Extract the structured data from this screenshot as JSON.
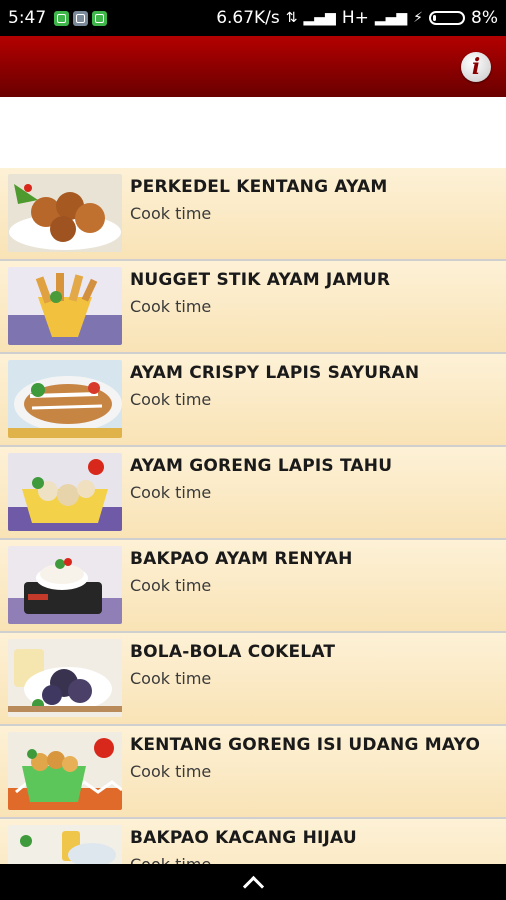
{
  "status_bar": {
    "time": "5:47",
    "speed": "6.67K/s",
    "network": "H+",
    "battery": "8%"
  },
  "app_bar": {
    "info_icon": "info-icon"
  },
  "colors": {
    "app_bar": "#8a0000",
    "row_background": "#fbe9c3"
  },
  "recipes": [
    {
      "title": "PERKEDEL KENTANG AYAM",
      "subtitle": "Cook time"
    },
    {
      "title": "NUGGET STIK AYAM JAMUR",
      "subtitle": "Cook time"
    },
    {
      "title": "AYAM CRISPY LAPIS SAYURAN",
      "subtitle": "Cook time"
    },
    {
      "title": "AYAM GORENG LAPIS TAHU",
      "subtitle": "Cook time"
    },
    {
      "title": "BAKPAO AYAM RENYAH",
      "subtitle": "Cook time"
    },
    {
      "title": "BOLA-BOLA COKELAT",
      "subtitle": "Cook time"
    },
    {
      "title": "KENTANG GORENG ISI UDANG MAYO",
      "subtitle": "Cook time"
    },
    {
      "title": "BAKPAO KACANG HIJAU",
      "subtitle": "Cook time"
    }
  ]
}
